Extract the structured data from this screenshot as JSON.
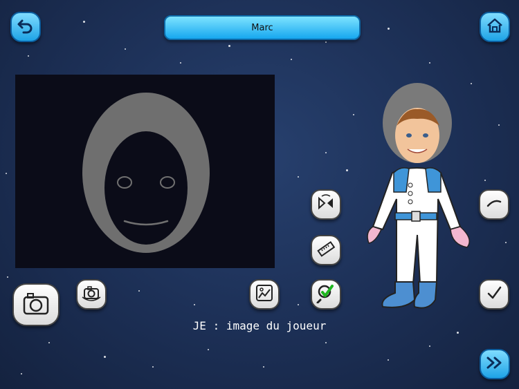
{
  "player": {
    "name": "Marc"
  },
  "caption": "JE : image du joueur",
  "colors": {
    "accent": "#1ea3e6",
    "background": "#1c2f55"
  },
  "icons": {
    "back": "undo-arrow-icon",
    "home": "home-icon",
    "camera_large": "camera-icon",
    "camera_switch": "camera-switch-icon",
    "image": "image-icon",
    "flip": "flip-icon",
    "ruler": "ruler-icon",
    "validate": "check-magnifier-icon",
    "dash": "dash-icon",
    "check": "check-icon",
    "next": "fast-forward-icon"
  }
}
